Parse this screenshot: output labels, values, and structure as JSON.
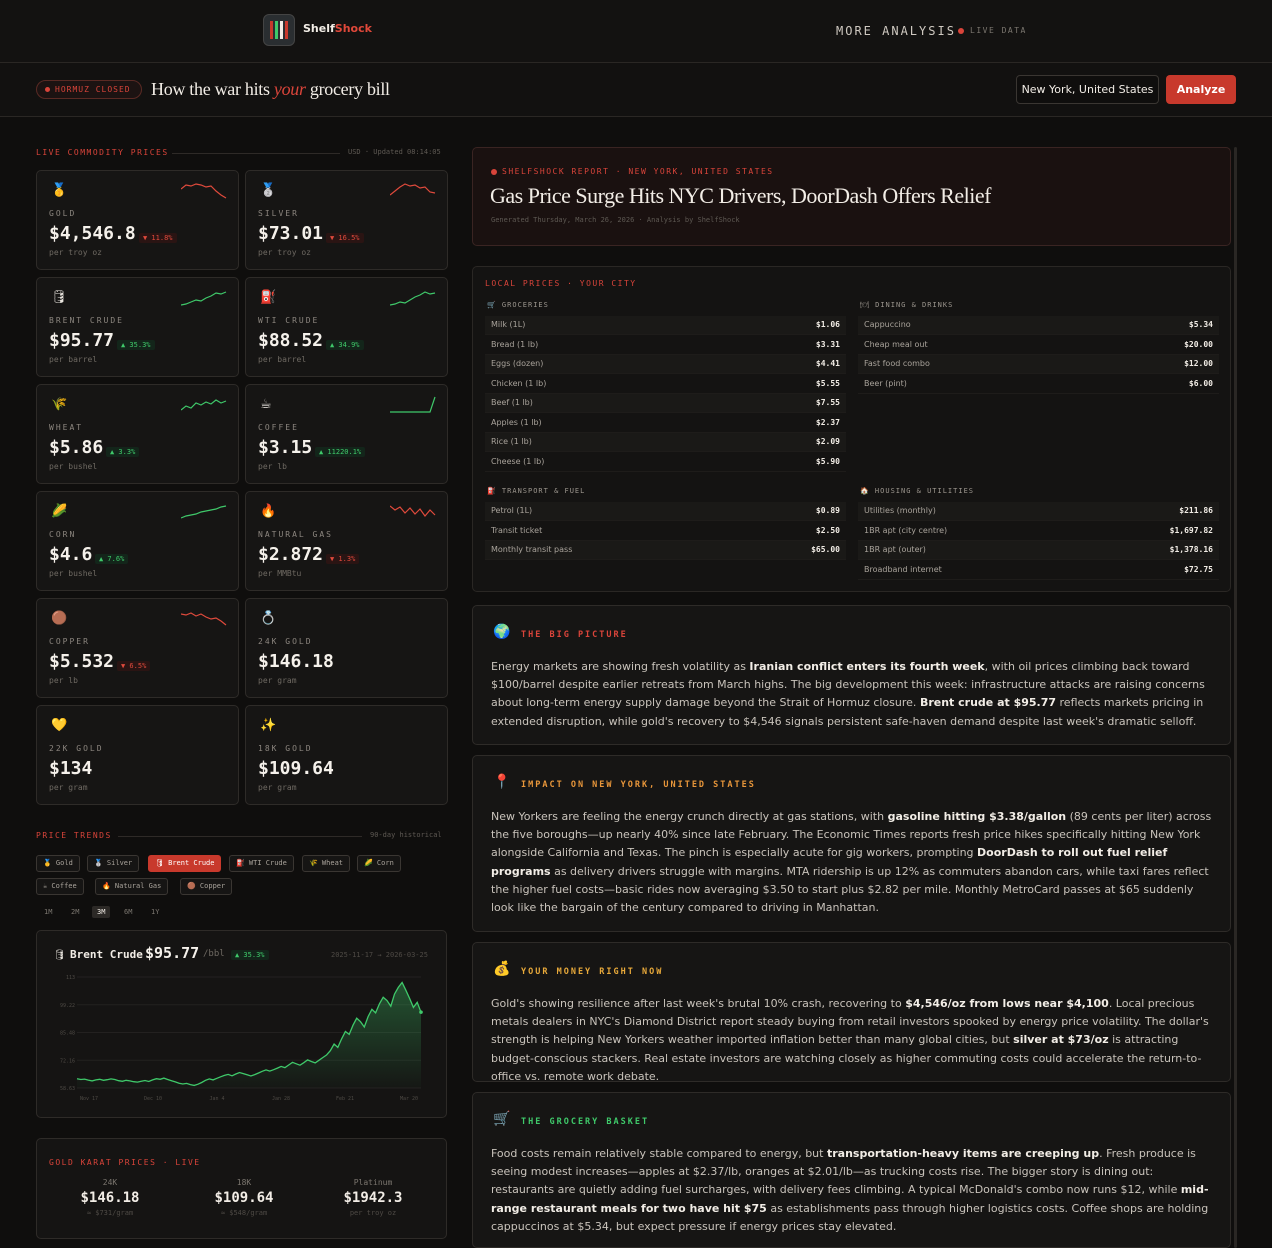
{
  "topbar": {
    "brand_part1": "Shelf",
    "brand_part2": "Shock",
    "more_analysis": "MORE ANALYSIS",
    "live_data": "LIVE DATA"
  },
  "header": {
    "badge": "HORMUZ CLOSED",
    "headline_pre": "How the war hits ",
    "headline_em": "your",
    "headline_post": " grocery bill",
    "location": "New York, United States",
    "analyze": "Analyze"
  },
  "commodities": {
    "label": "LIVE COMMODITY PRICES",
    "meta": "USD · Updated 08:14:05",
    "cards": [
      {
        "icon": "gold-medal-icon",
        "glyph": "🥇",
        "name": "GOLD",
        "price": "$4,546.8",
        "change": "▼ 11.8%",
        "dir": "dn",
        "unit": "per troy oz",
        "spark": [
          6,
          2,
          3,
          1,
          2,
          4,
          3,
          8,
          12,
          15
        ]
      },
      {
        "icon": "silver-medal-icon",
        "glyph": "🥈",
        "name": "SILVER",
        "price": "$73.01",
        "change": "▼ 16.5%",
        "dir": "dn",
        "unit": "per troy oz",
        "spark": [
          12,
          8,
          4,
          1,
          3,
          2,
          5,
          4,
          9,
          10
        ]
      },
      {
        "icon": "barrel-icon",
        "glyph": "🛢",
        "name": "BRENT CRUDE",
        "price": "$95.77",
        "change": "▲ 35.3%",
        "dir": "up",
        "unit": "per barrel",
        "spark": [
          15,
          14,
          12,
          10,
          11,
          8,
          6,
          3,
          4,
          2
        ]
      },
      {
        "icon": "fuel-pump-icon",
        "glyph": "⛽",
        "name": "WTI CRUDE",
        "price": "$88.52",
        "change": "▲ 34.9%",
        "dir": "up",
        "unit": "per barrel",
        "spark": [
          15,
          14,
          12,
          13,
          10,
          7,
          5,
          2,
          4,
          3
        ]
      },
      {
        "icon": "wheat-icon",
        "glyph": "🌾",
        "name": "WHEAT",
        "price": "$5.86",
        "change": "▲ 3.3%",
        "dir": "up",
        "unit": "per bushel",
        "spark": [
          13,
          9,
          11,
          6,
          8,
          5,
          7,
          3,
          6,
          4
        ]
      },
      {
        "icon": "coffee-icon",
        "glyph": "☕",
        "name": "COFFEE",
        "price": "$3.15",
        "change": "▲ 11220.1%",
        "dir": "up",
        "unit": "per lb",
        "spark": [
          15,
          15,
          15,
          15,
          15,
          15,
          15,
          15,
          15,
          0
        ]
      },
      {
        "icon": "corn-icon",
        "glyph": "🌽",
        "name": "CORN",
        "price": "$4.6",
        "change": "▲ 7.6%",
        "dir": "up",
        "unit": "per bushel",
        "spark": [
          14,
          12,
          11,
          10,
          8,
          7,
          6,
          5,
          3,
          2
        ]
      },
      {
        "icon": "flame-icon",
        "glyph": "🔥",
        "name": "NATURAL GAS",
        "price": "$2.872",
        "change": "▼ 1.3%",
        "dir": "dn",
        "unit": "per MMBtu",
        "spark": [
          2,
          6,
          3,
          9,
          4,
          10,
          5,
          12,
          6,
          11
        ]
      },
      {
        "icon": "copper-icon",
        "glyph": "🟤",
        "name": "COPPER",
        "price": "$5.532",
        "change": "▼ 6.5%",
        "dir": "dn",
        "unit": "per lb",
        "spark": [
          3,
          4,
          2,
          5,
          3,
          6,
          8,
          7,
          10,
          14
        ]
      },
      {
        "icon": "ring-icon",
        "glyph": "💍",
        "name": "24K GOLD",
        "price": "$146.18",
        "change": "",
        "dir": "",
        "unit": "per gram",
        "spark": []
      },
      {
        "icon": "heart-icon",
        "glyph": "💛",
        "name": "22K GOLD",
        "price": "$134",
        "change": "",
        "dir": "",
        "unit": "per gram",
        "spark": []
      },
      {
        "icon": "sparkles-icon",
        "glyph": "✨",
        "name": "18K GOLD",
        "price": "$109.64",
        "change": "",
        "dir": "",
        "unit": "per gram",
        "spark": []
      }
    ]
  },
  "trends": {
    "label": "PRICE TRENDS",
    "meta": "90-day historical",
    "chips": [
      "🥇 Gold",
      "🥈 Silver",
      "🛢 Brent Crude",
      "⛽ WTI Crude",
      "🌾 Wheat",
      "🌽 Corn",
      "☕ Coffee",
      "🔥 Natural Gas",
      "🟤 Copper"
    ],
    "ranges": [
      "1M",
      "2M",
      "3M",
      "6M",
      "1Y"
    ],
    "chart_title": "Brent Crude",
    "chart_price": "$95.77",
    "chart_unit": "/bbl",
    "chart_change": "▲ 35.3%",
    "chart_dates": "2025-11-17 → 2026-03-25"
  },
  "chart_data": {
    "type": "area",
    "title": "Brent Crude",
    "xlabel": "",
    "ylabel": "",
    "y_ticks": [
      "113",
      "99.22",
      "85.48",
      "72.16",
      "58.63"
    ],
    "x_ticks": [
      "Nov 17",
      "Dec 10",
      "Jan 4",
      "Jan 28",
      "Feb 21",
      "Mar 20"
    ],
    "ylim": [
      58.63,
      113
    ],
    "series": [
      {
        "values": [
          63.2,
          62.8,
          63.0,
          62.5,
          62.1,
          62.6,
          62.9,
          62.4,
          62.7,
          63.1,
          62.8,
          62.2,
          61.9,
          62.4,
          62.1,
          61.7,
          61.5,
          61.9,
          62.3,
          61.8,
          62.6,
          63.2,
          62.9,
          63.5,
          62.8,
          62.2,
          61.6,
          61.0,
          60.6,
          60.9,
          60.3,
          59.9,
          60.5,
          61.3,
          62.4,
          63.1,
          62.6,
          63.4,
          64.1,
          64.8,
          65.3,
          64.6,
          65.5,
          66.2,
          65.7,
          65.1,
          64.5,
          65.2,
          66.0,
          66.8,
          67.5,
          66.9,
          67.6,
          68.4,
          69.2,
          68.6,
          69.9,
          71.2,
          70.5,
          69.8,
          71.0,
          72.4,
          71.6,
          70.9,
          72.2,
          73.5,
          74.8,
          76.9,
          80.2,
          78.5,
          82.7,
          86.3,
          84.9,
          89.4,
          92.8,
          91.1,
          88.5,
          93.6,
          97.2,
          95.4,
          99.8,
          103.1,
          101.5,
          98.7,
          104.6,
          107.9,
          110.3,
          106.5,
          102.4,
          98.1,
          100.6,
          95.77
        ]
      }
    ]
  },
  "karat": {
    "label": "GOLD KARAT PRICES · LIVE",
    "cols": [
      {
        "label": "24K",
        "value": "$146.18",
        "sub": "≈ $731/gram"
      },
      {
        "label": "18K",
        "value": "$109.64",
        "sub": "≈ $548/gram"
      },
      {
        "label": "Platinum",
        "value": "$1942.3",
        "sub": "per troy oz"
      }
    ]
  },
  "report": {
    "kicker": "SHELFSHOCK REPORT · NEW YORK, UNITED STATES",
    "title": "Gas Price Surge Hits NYC Drivers, DoorDash Offers Relief",
    "meta": "Generated Thursday, March 26, 2026 · Analysis by ShelfShock"
  },
  "local_prices": {
    "label": "LOCAL PRICES · YOUR CITY",
    "groceries": {
      "title": "🛒 GROCERIES",
      "rows": [
        [
          "Milk (1L)",
          "$1.06"
        ],
        [
          "Bread (1 lb)",
          "$3.31"
        ],
        [
          "Eggs (dozen)",
          "$4.41"
        ],
        [
          "Chicken (1 lb)",
          "$5.55"
        ],
        [
          "Beef (1 lb)",
          "$7.55"
        ],
        [
          "Apples (1 lb)",
          "$2.37"
        ],
        [
          "Rice (1 lb)",
          "$2.09"
        ],
        [
          "Cheese (1 lb)",
          "$5.90"
        ]
      ]
    },
    "dining": {
      "title": "🍽 DINING & DRINKS",
      "rows": [
        [
          "Cappuccino",
          "$5.34"
        ],
        [
          "Cheap meal out",
          "$20.00"
        ],
        [
          "Fast food combo",
          "$12.00"
        ],
        [
          "Beer (pint)",
          "$6.00"
        ]
      ]
    },
    "transport": {
      "title": "⛽ TRANSPORT & FUEL",
      "rows": [
        [
          "Petrol (1L)",
          "$0.89"
        ],
        [
          "Transit ticket",
          "$2.50"
        ],
        [
          "Monthly transit pass",
          "$65.00"
        ]
      ]
    },
    "housing": {
      "title": "🏠 HOUSING & UTILITIES",
      "rows": [
        [
          "Utilities (monthly)",
          "$211.86"
        ],
        [
          "1BR apt (city centre)",
          "$1,697.82"
        ],
        [
          "1BR apt (outer)",
          "$1,378.16"
        ],
        [
          "Broadband internet",
          "$72.75"
        ]
      ]
    }
  },
  "articles": [
    {
      "icon": "globe-icon",
      "glyph": "🌍",
      "title": "THE BIG PICTURE",
      "color": "#d9443a",
      "body": "Energy markets are showing fresh volatility as <b>Iranian conflict enters its fourth week</b>, with oil prices climbing back toward $100/barrel despite earlier retreats from March highs. The big development this week: infrastructure attacks are raising concerns about long-term energy supply damage beyond the Strait of Hormuz closure. <b>Brent crude at $95.77</b> reflects markets pricing in extended disruption, while gold's recovery to $4,546 signals persistent safe-haven demand despite last week's dramatic selloff."
    },
    {
      "icon": "pin-icon",
      "glyph": "📍",
      "title": "IMPACT ON NEW YORK, UNITED STATES",
      "color": "#e8963a",
      "body": "New Yorkers are feeling the energy crunch directly at gas stations, with <b>gasoline hitting $3.38/gallon</b> (89 cents per liter) across the five boroughs—up nearly 40% since late February. The Economic Times reports fresh price hikes specifically hitting New York alongside California and Texas. The pinch is especially acute for gig workers, prompting <b>DoorDash to roll out fuel relief programs</b> as delivery drivers struggle with margins. MTA ridership is up 12% as commuters abandon cars, while taxi fares reflect the higher fuel costs—basic rides now averaging $3.50 to start plus $2.82 per mile. Monthly MetroCard passes at $65 suddenly look like the bargain of the century compared to driving in Manhattan."
    },
    {
      "icon": "money-bag-icon",
      "glyph": "💰",
      "title": "YOUR MONEY RIGHT NOW",
      "color": "#e8a93a",
      "body": "Gold's showing resilience after last week's brutal 10% crash, recovering to <b>$4,546/oz from lows near $4,100</b>. Local precious metals dealers in NYC's Diamond District report steady buying from retail investors spooked by energy price volatility. The dollar's strength is helping New Yorkers weather imported inflation better than many global cities, but <b>silver at $73/oz</b> is attracting budget-conscious stackers. Real estate investors are watching closely as higher commuting costs could accelerate the return-to-office vs. remote work debate."
    },
    {
      "icon": "cart-icon",
      "glyph": "🛒",
      "title": "THE GROCERY BASKET",
      "color": "#3fc96a",
      "body": "Food costs remain relatively stable compared to energy, but <b>transportation-heavy items are creeping up</b>. Fresh produce is seeing modest increases—apples at $2.37/lb, oranges at $2.01/lb—as trucking costs rise. The bigger story is dining out: restaurants are quietly adding fuel surcharges, with delivery fees climbing. A typical McDonald's combo now runs $12, while <b>mid-range restaurant meals for two have hit $75</b> as establishments pass through higher logistics costs. Coffee shops are holding cappuccinos at $5.34, but expect pressure if energy prices stay elevated."
    }
  ],
  "colors": {
    "accent": "#c8392c",
    "up": "#3fc96a",
    "down": "#e04a3c",
    "bg": "#0f0e0d"
  }
}
